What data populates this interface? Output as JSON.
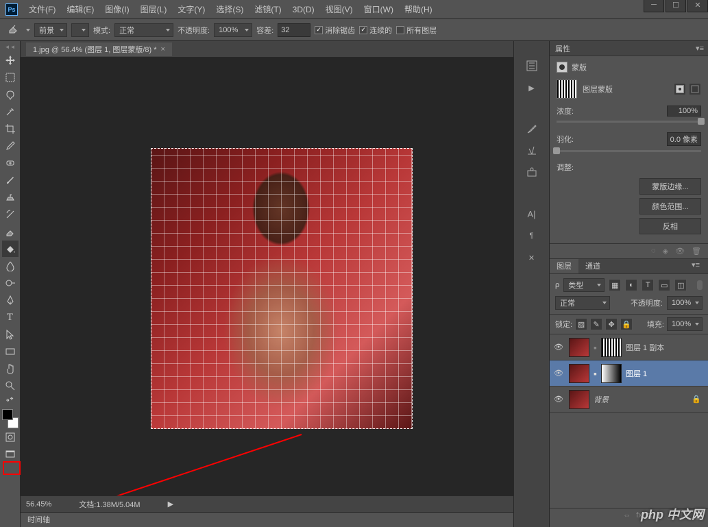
{
  "app": {
    "logo": "Ps"
  },
  "menu": [
    "文件(F)",
    "编辑(E)",
    "图像(I)",
    "图层(L)",
    "文字(Y)",
    "选择(S)",
    "滤镜(T)",
    "3D(D)",
    "视图(V)",
    "窗口(W)",
    "帮助(H)"
  ],
  "options": {
    "fill_target": "前景",
    "mode_label": "模式:",
    "mode_value": "正常",
    "opacity_label": "不透明度:",
    "opacity_value": "100%",
    "tolerance_label": "容差:",
    "tolerance_value": "32",
    "antialias": "消除锯齿",
    "contiguous": "连续的",
    "all_layers": "所有图层"
  },
  "doc_tab": "1.jpg @ 56.4% (图层 1, 图层蒙版/8) *",
  "status": {
    "zoom": "56.45%",
    "doc": "文档:1.38M/5.04M"
  },
  "timeline": "时间轴",
  "properties": {
    "title": "属性",
    "mask_label": "蒙版",
    "mask_type": "图层蒙版",
    "density_label": "浓度:",
    "density_value": "100%",
    "feather_label": "羽化:",
    "feather_value": "0.0 像素",
    "adjust_label": "调整:",
    "btn_edge": "蒙版边缘...",
    "btn_color": "颜色范围...",
    "btn_invert": "反相"
  },
  "layers": {
    "tab_layers": "图层",
    "tab_channels": "通道",
    "filter_kind": "类型",
    "blend_mode": "正常",
    "opacity_label": "不透明度:",
    "opacity_value": "100%",
    "lock_label": "锁定:",
    "fill_label": "填充:",
    "fill_value": "100%",
    "items": [
      {
        "name": "图层 1 副本"
      },
      {
        "name": "图层 1"
      },
      {
        "name": "背景"
      }
    ]
  },
  "watermark": "php 中文网"
}
